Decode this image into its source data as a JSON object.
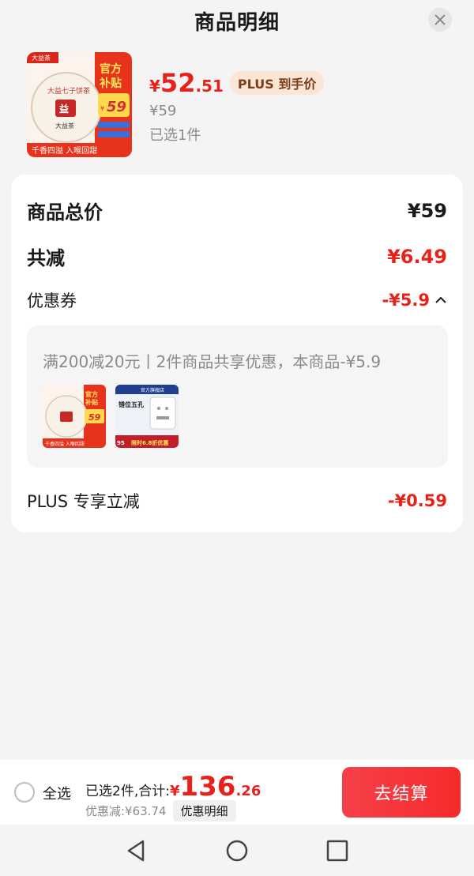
{
  "header": {
    "title": "商品明细",
    "close_icon": "close-icon"
  },
  "product": {
    "price_yen": "¥",
    "price_int": "52",
    "price_dec": ".51",
    "plus_badge": "PLUS 到手价",
    "original_price": "¥59",
    "selected": "已选1件",
    "image": {
      "brand_small": "大益茶",
      "official": "官方",
      "subsidy": "补贴",
      "promo_price": "59",
      "yen": "¥",
      "slogan": "千香四溢 入喉回甜",
      "seal_text": "大益七子饼茶",
      "seal_logo": "大益茶"
    }
  },
  "summary": {
    "total_label": "商品总价",
    "total_value": "¥59",
    "reduce_label": "共减",
    "reduce_value": "¥6.49",
    "coupon_label": "优惠券",
    "coupon_value": "-¥5.9",
    "coupon_desc": "满200减20元丨2件商品共享优惠，本商品-¥5.9",
    "coupon_thumbs": {
      "t1": {
        "promo_price": "59",
        "slogan": "千香四溢 入喉回甜",
        "official": "官方",
        "subsidy": "补贴"
      },
      "t2": {
        "title": "错位五孔",
        "price": "95",
        "sale": "限时6.8折优惠",
        "tag": "官方旗舰店"
      }
    },
    "plus_label": "PLUS 专享立减",
    "plus_value": "-¥0.59"
  },
  "bottom": {
    "select_all": "全选",
    "sum_label": "已选2件,合计:",
    "sum_yen": "¥",
    "sum_int": "136",
    "sum_dec": ".26",
    "discount": "优惠减:¥63.74",
    "detail_button": "优惠明细",
    "checkout": "去结算"
  },
  "colors": {
    "accent": "#e8221b",
    "checkout_bg": "#f5404a",
    "badge_bg": "#fbe6d6"
  }
}
